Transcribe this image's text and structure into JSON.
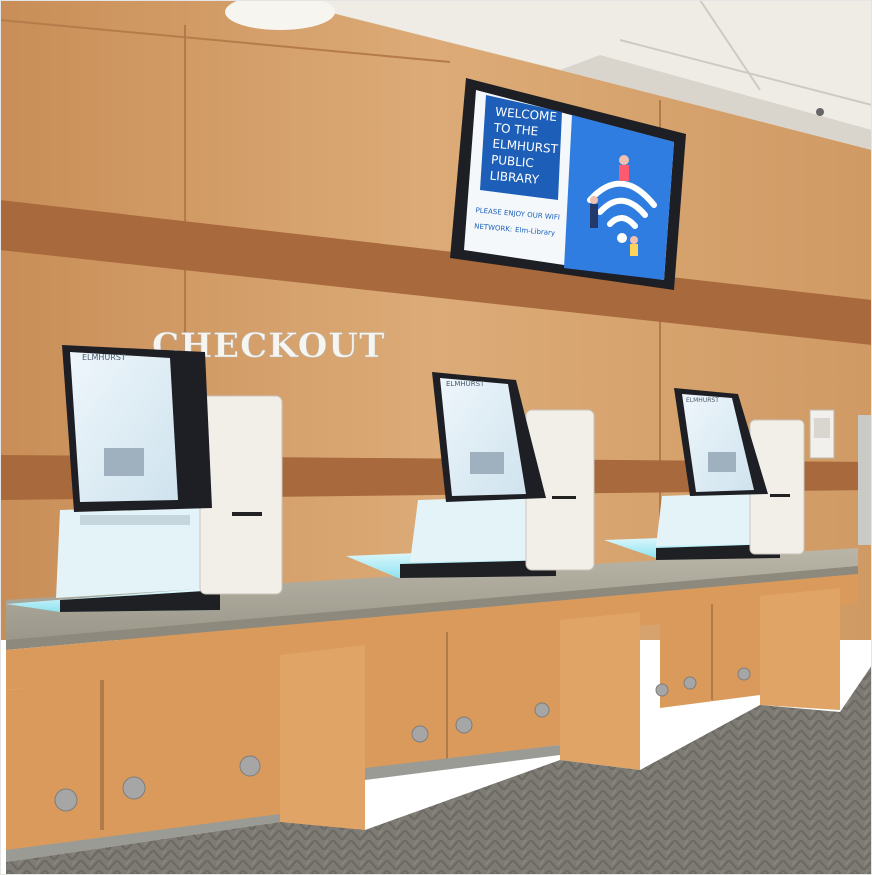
{
  "sign": {
    "text": "CHECKOUT"
  },
  "monitor": {
    "welcome_lines": [
      "WELCOME",
      "TO THE",
      "ELMHURST",
      "PUBLIC",
      "LIBRARY"
    ],
    "wifi_note": "PLEASE ENJOY OUR WIFI",
    "network_label": "NETWORK:",
    "network_name": "Elm-Library"
  },
  "kiosks": [
    {
      "brand": "ELMHURST"
    },
    {
      "brand": "ELMHURST"
    },
    {
      "brand": "ELMHURST"
    }
  ],
  "colors": {
    "wall": "#d6a06b",
    "wall_band": "#a8693c",
    "counter_top": "#a9a596",
    "cabinet": "#d99a5c",
    "screen_blue": "#2f7de0",
    "welcome_box": "#1d5fb8",
    "kiosk_glow": "#bfeff6",
    "carpet": "#7c7a73"
  }
}
